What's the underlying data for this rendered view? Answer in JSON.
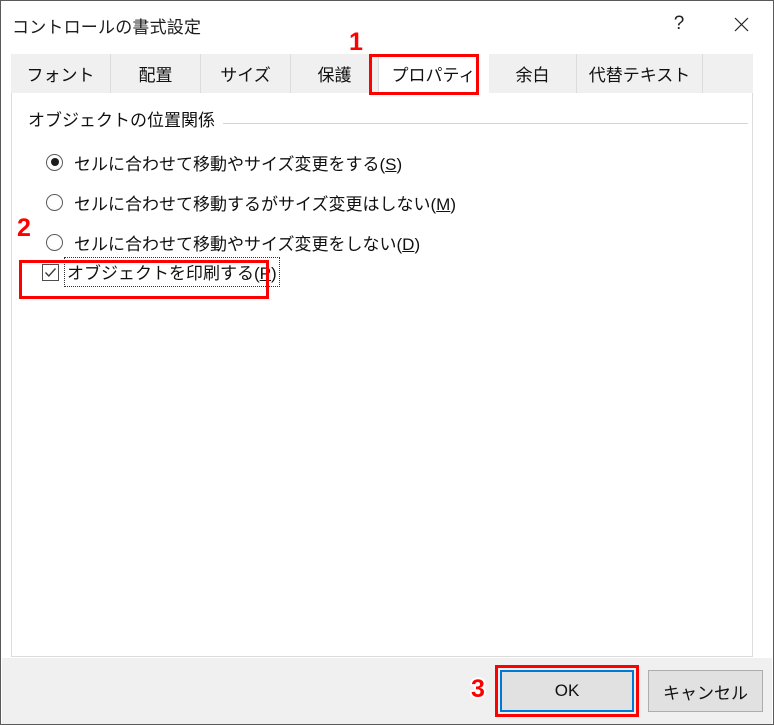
{
  "window": {
    "title": "コントロールの書式設定",
    "help_icon": "question-mark-icon",
    "close_icon": "close-icon"
  },
  "tabs": [
    {
      "label": "フォント",
      "selected": false
    },
    {
      "label": "配置",
      "selected": false
    },
    {
      "label": "サイズ",
      "selected": false
    },
    {
      "label": "保護",
      "selected": false
    },
    {
      "label": "プロパティ",
      "selected": true
    },
    {
      "label": "余白",
      "selected": false
    },
    {
      "label": "代替テキスト",
      "selected": false
    }
  ],
  "panel": {
    "group_label": "オブジェクトの位置関係",
    "radios": [
      {
        "label": "セルに合わせて移動やサイズ変更をする(S)",
        "accel": "S",
        "checked": true
      },
      {
        "label": "セルに合わせて移動するがサイズ変更はしない(M)",
        "accel": "M",
        "checked": false
      },
      {
        "label": "セルに合わせて移動やサイズ変更をしない(D)",
        "accel": "D",
        "checked": false
      }
    ],
    "checkbox": {
      "label": "オブジェクトを印刷する(P)",
      "accel": "P",
      "checked": true
    }
  },
  "footer": {
    "ok_label": "OK",
    "cancel_label": "キャンセル"
  },
  "annotations": {
    "step_1": "1",
    "step_2": "2",
    "step_3": "3",
    "color": "#ff0000"
  }
}
